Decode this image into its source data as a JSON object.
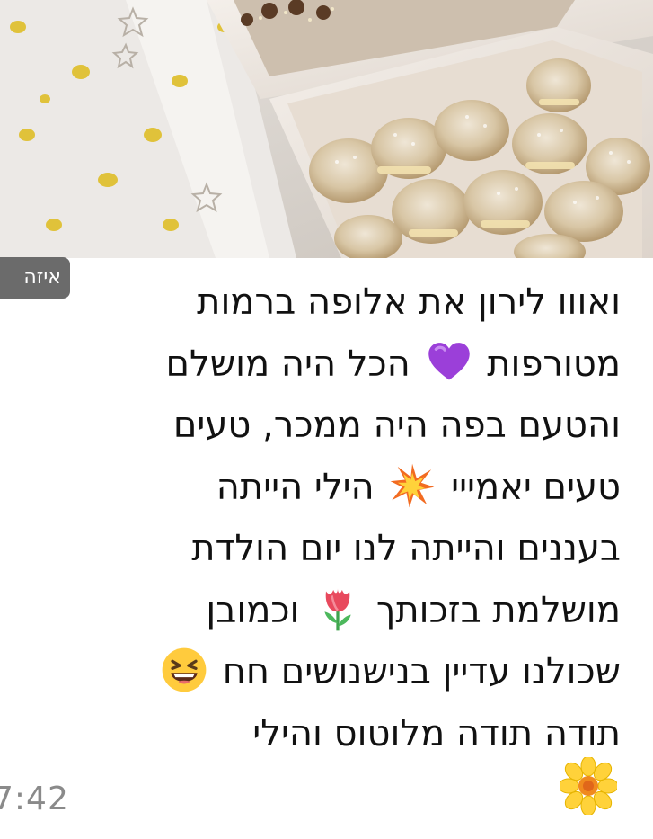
{
  "side_chip": {
    "label": "איזה"
  },
  "message": {
    "lines": [
      "ואווו לירון את אלופה ברמות",
      "הכל היה מושלם",
      "מטורפות",
      "והטעם בפה היה ממכר, טעים",
      "הילי הייתה",
      "טעים יאמייי",
      "בעננים והייתה לנו יום הולדת",
      "וכמובן",
      "מושלמת בזכותך",
      "שכולנו עדיין בנישנושים חח",
      "תודה תודה מלוטוס והילי"
    ],
    "emojis": {
      "purple_heart": "purple-heart-emoji",
      "collision": "collision-emoji",
      "tulip": "tulip-emoji",
      "laughing": "laughing-face-emoji",
      "blossom": "blossom-emoji"
    }
  },
  "timestamp": {
    "time": "7:42"
  },
  "photo": {
    "description_icon": "photo-of-pastries-in-box"
  },
  "colors": {
    "text": "#111111",
    "timestamp": "#8a8a8a",
    "chip_background": "#6b6b6b"
  }
}
